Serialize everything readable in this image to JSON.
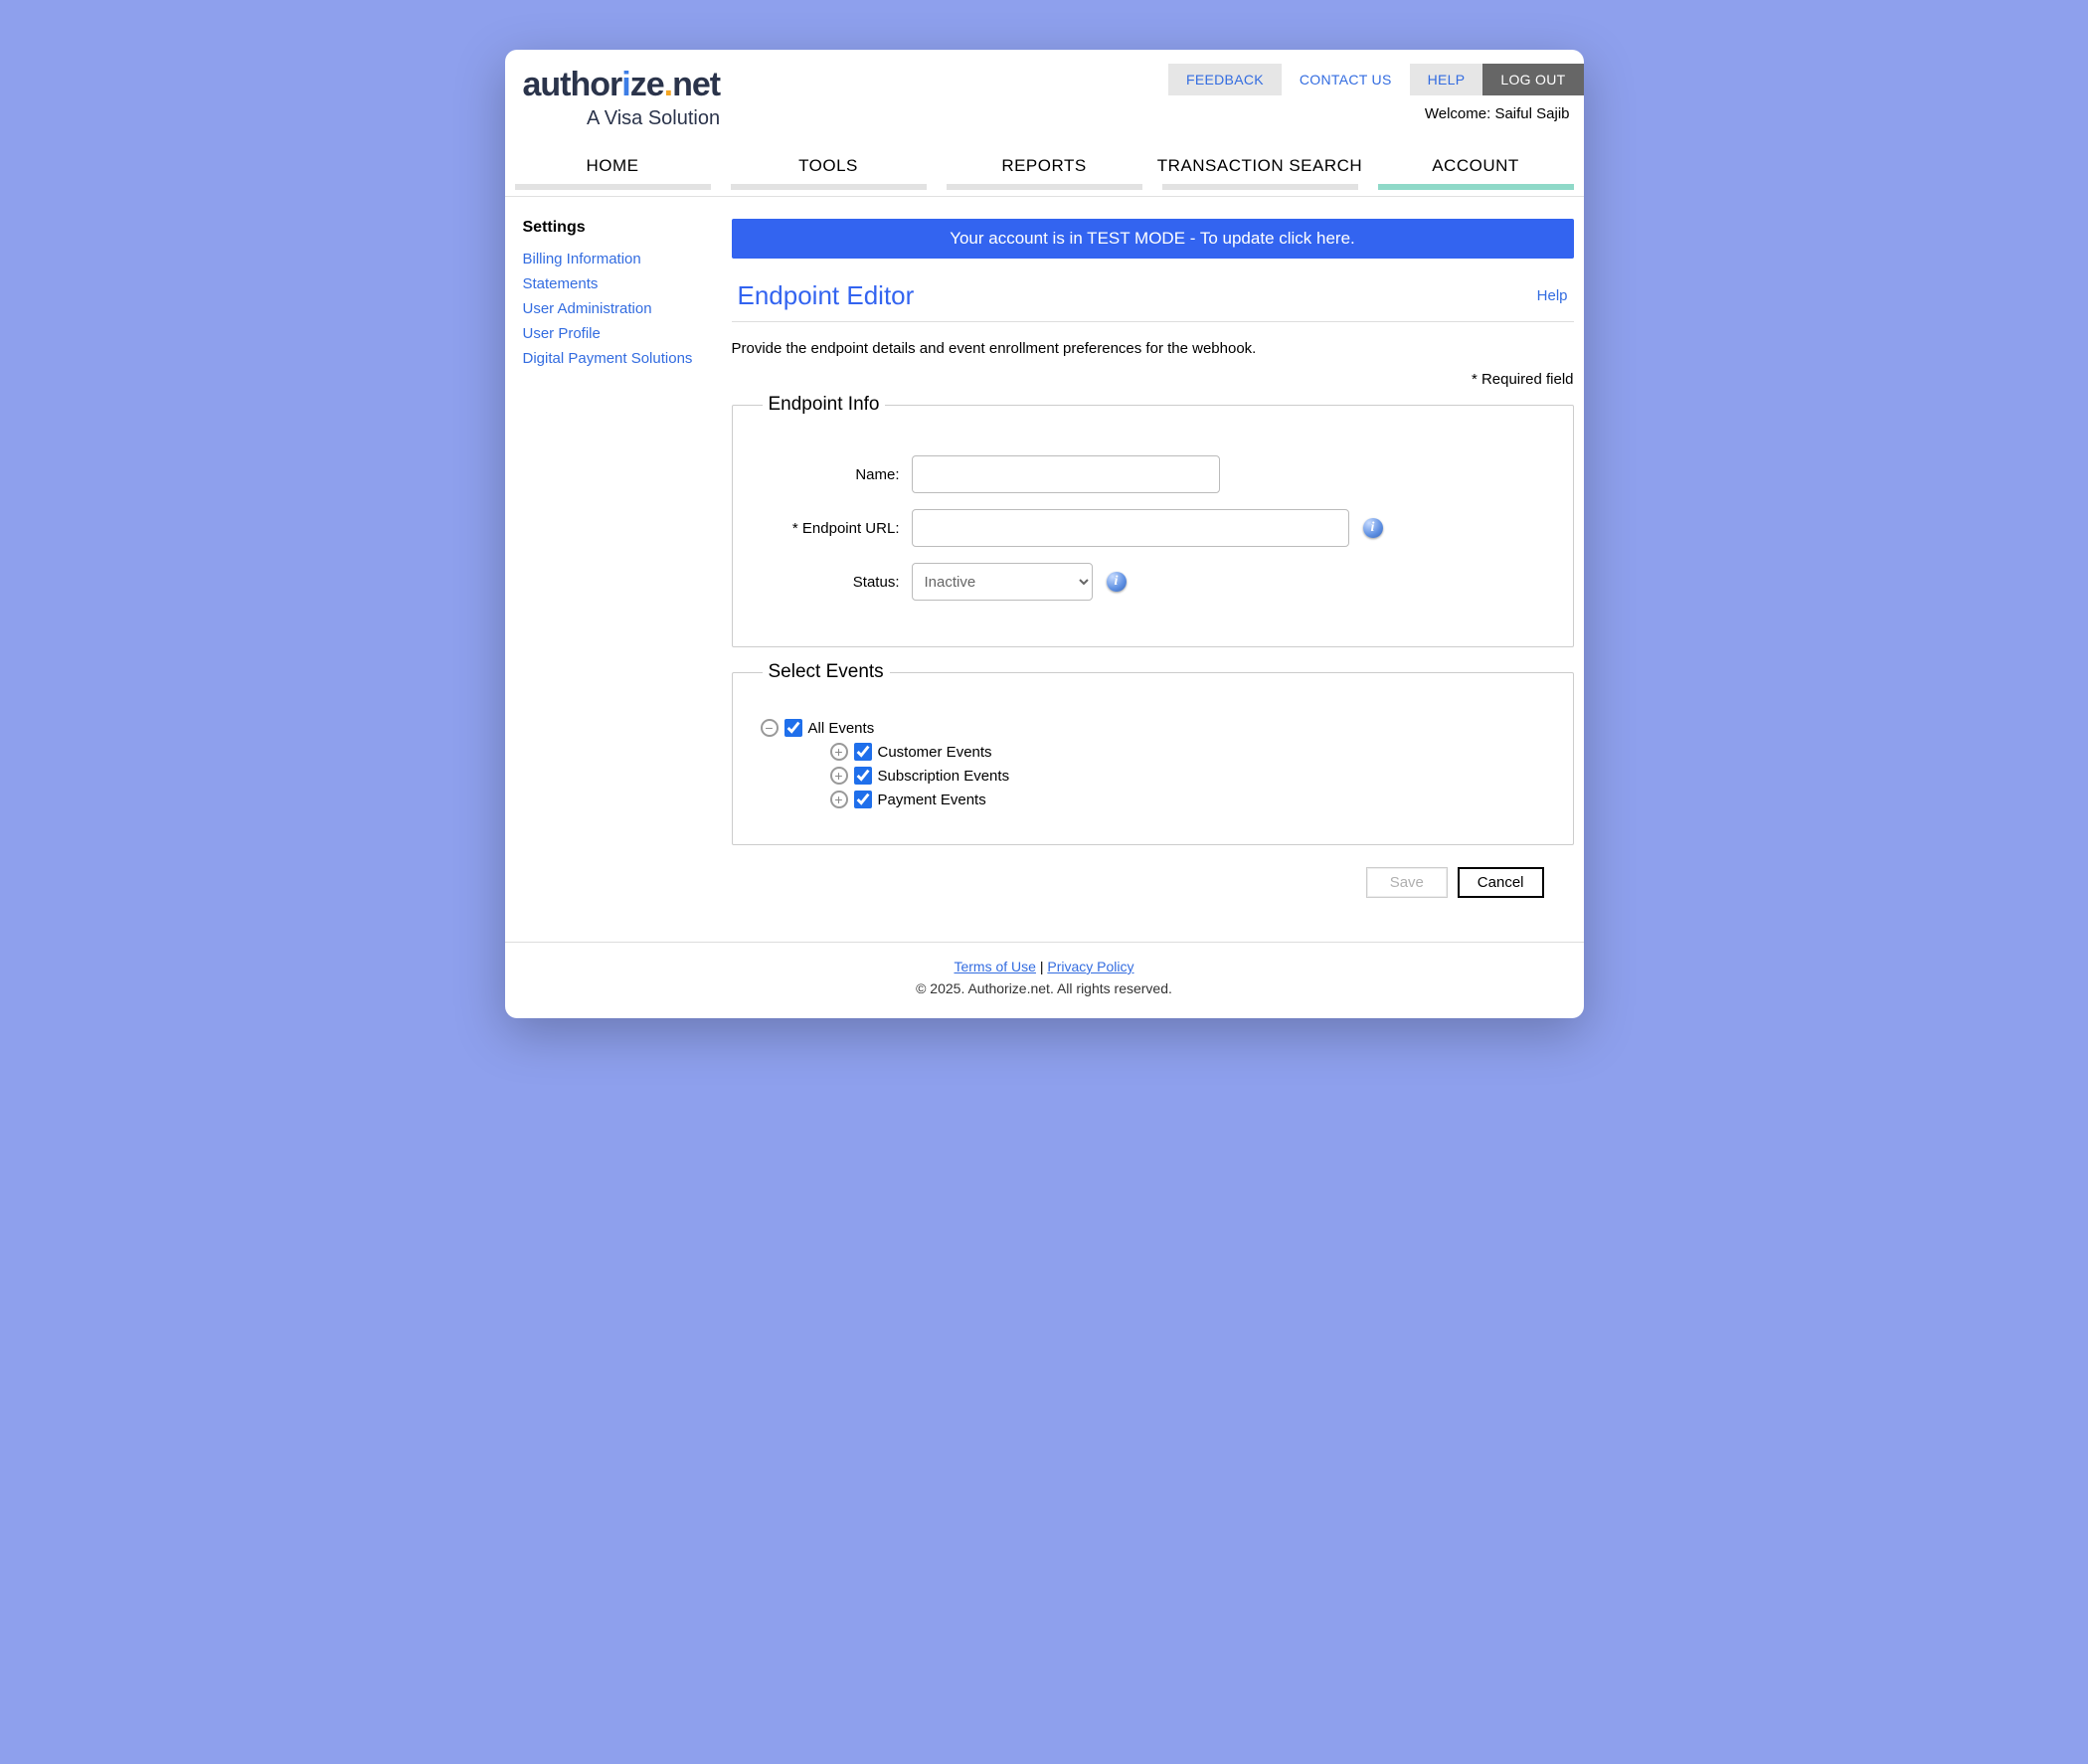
{
  "toplinks": {
    "feedback": "FEEDBACK",
    "contact": "CONTACT US",
    "help": "HELP",
    "logout": "LOG OUT"
  },
  "welcome_prefix": "Welcome: ",
  "welcome_name": "Saiful Sajib",
  "nav": {
    "home": "HOME",
    "tools": "TOOLS",
    "reports": "REPORTS",
    "txsearch": "TRANSACTION SEARCH",
    "account": "ACCOUNT"
  },
  "sidebar": {
    "heading": "Settings",
    "items": [
      "Billing Information",
      "Statements",
      "User Administration",
      "User Profile",
      "Digital Payment Solutions"
    ]
  },
  "banner": "Your account is in TEST MODE - To update click here.",
  "page": {
    "title": "Endpoint Editor",
    "help": "Help",
    "description": "Provide the endpoint details and event enrollment preferences for the webhook.",
    "required_note": "* Required field"
  },
  "endpoint_info": {
    "legend": "Endpoint Info",
    "name_label": "Name:",
    "name_value": "",
    "url_label": "* Endpoint URL:",
    "url_value": "",
    "status_label": "Status:",
    "status_selected": "Inactive"
  },
  "events": {
    "legend": "Select Events",
    "all": "All Events",
    "customer": "Customer Events",
    "subscription": "Subscription Events",
    "payment": "Payment Events"
  },
  "buttons": {
    "save": "Save",
    "cancel": "Cancel"
  },
  "footer": {
    "terms": "Terms of Use",
    "sep": "  |  ",
    "privacy": "Privacy Policy",
    "copyright": "© 2025. Authorize.net. All rights reserved."
  }
}
